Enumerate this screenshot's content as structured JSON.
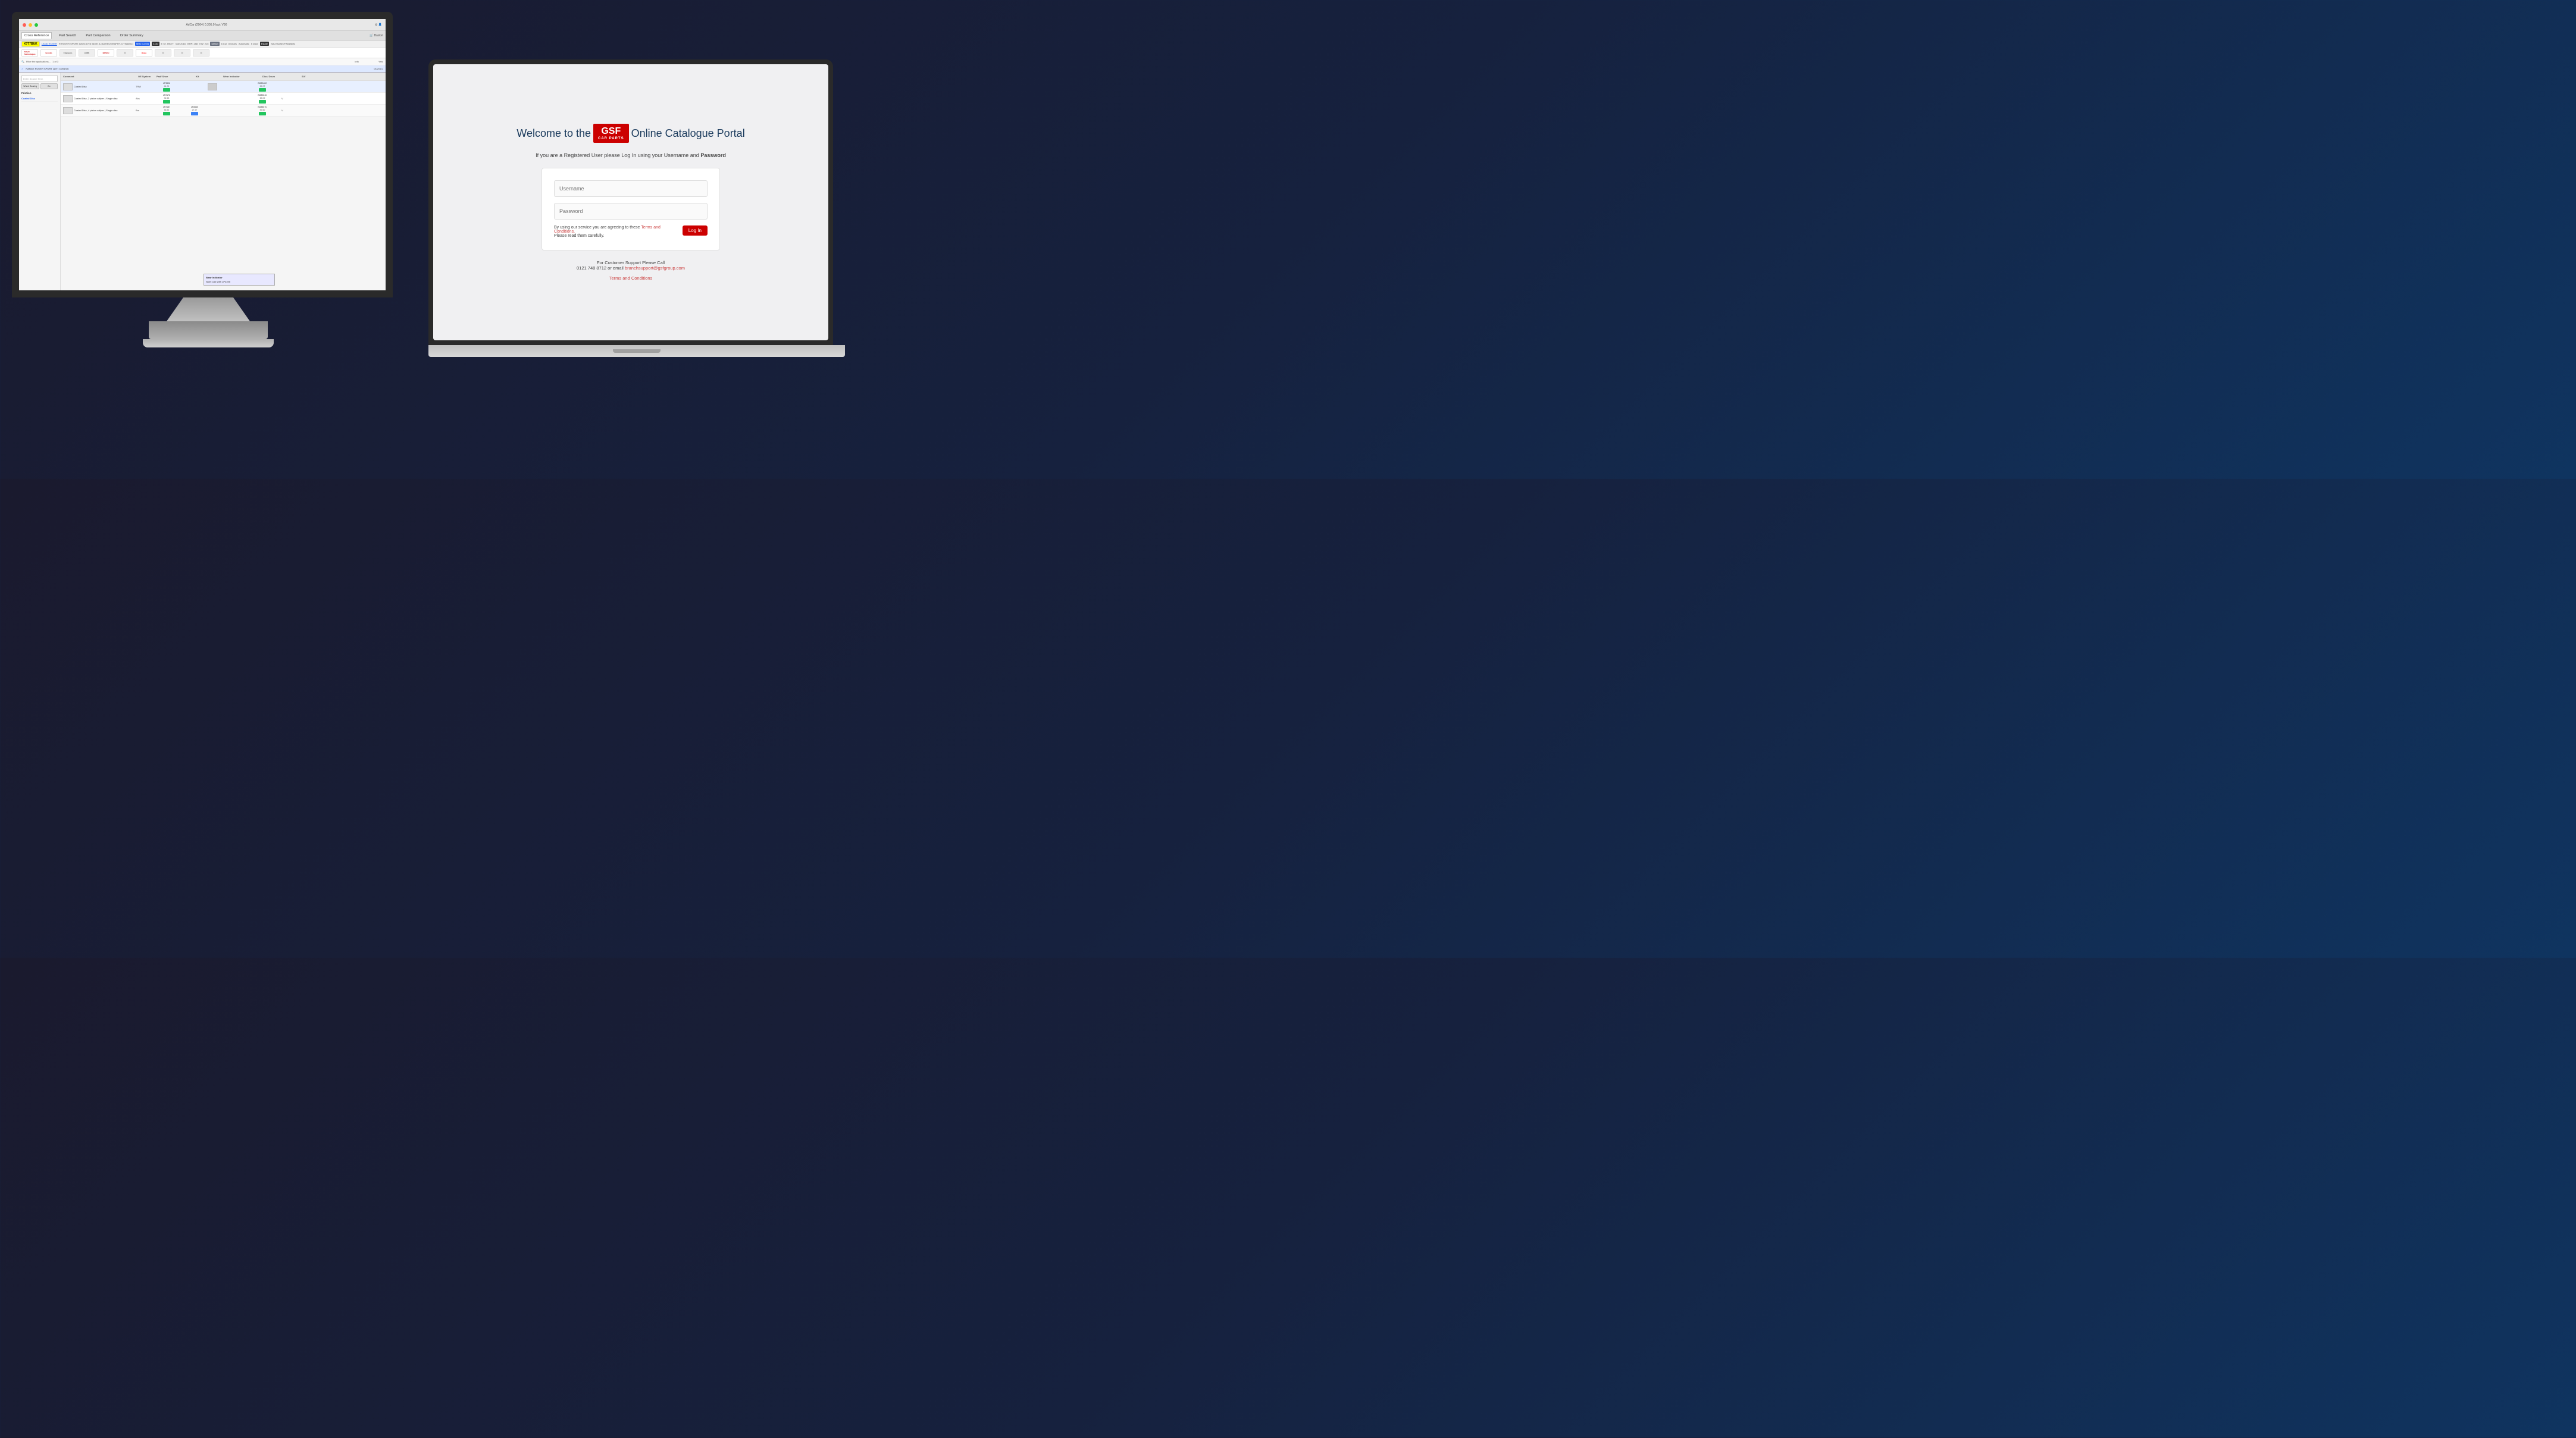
{
  "monitor": {
    "window_controls": [
      "red",
      "yellow",
      "green"
    ],
    "topbar_center": "AdCar (2964)  0.305.0  lapi: V90",
    "topbar_right": "⚙  👤"
  },
  "app": {
    "nav_tabs": [
      "Cross Reference",
      "Part Search",
      "Part Comparison",
      "Order Summary"
    ],
    "basket_label": "🛒 Basket",
    "reg_plate": "K777BUK",
    "vehicle_make": "LAND ROVER",
    "vehicle_model": "R ROVER SPORT A8OG DYN 5DVE A (AUTBIOGRAPHY, DYNAMIC)",
    "vehicle_mhz": "MH2 (L494)",
    "vehicle_body": "3.0D",
    "vehicle_engine": "E Or. 5907T",
    "vehicle_date": "Mar 2016",
    "vehicle_hp": "Hyp: 120/114",
    "vehicle_bhp": "BHP: 258",
    "vehicle_kw": "KW: 215",
    "vehicle_fuel": "Diesel",
    "vehicle_cyl": "6 Cyl",
    "vehicle_valve": "24 V",
    "vehicle_el": "El",
    "vehicle_gears": "8 Gears",
    "vehicle_trans": "Automatic",
    "vehicle_doors": "5 Door",
    "vehicle_body_style": "Estate",
    "vehicle_vin": "SALHA2AE7FA518892",
    "brands": [
      "Delphi Technologies",
      "brembo",
      "Champion",
      "LEMFÖRDER",
      "BOSCH",
      "Brake",
      "Autodata"
    ],
    "filter_text": "Filter the applications...",
    "filter_count": "1 of 3",
    "info_label": "Info",
    "year_label": "Year",
    "application": {
      "name": "RANGE ROVER SPORT (13+) 3.0SDV6",
      "year": "04/2013-"
    },
    "sidebar": {
      "search_placeholder": "Enter Search Term",
      "btn1": "Wheel Bearing",
      "btn2": "Go",
      "section": "Friction",
      "items": [
        "Coated Disc"
      ]
    },
    "table": {
      "columns": [
        "Comment",
        "OE System",
        "Pad/ Shoe",
        "Kit",
        "Wear Indicator",
        "Disc/ Drum",
        "S/V"
      ],
      "rows": [
        {
          "comment": "Coated Disc",
          "system": "TRW",
          "pad_num": "LP3396",
          "pad_size": "44.74",
          "disc_num": "BG8348C",
          "disc_size": "52.07"
        },
        {
          "comment": "Coated Disc, 2 piston caliper | Single disc",
          "system": "Abs",
          "pad_num": "LP2176",
          "pad_size": "32.63",
          "disc_num": "BG8304C",
          "disc_size": "65.09"
        },
        {
          "comment": "Coated Disc, 4 piston caliper | Single disc",
          "system": "Bre",
          "pad_num": "LP2187",
          "pad_size": "56.52",
          "kit_num": "LK0640",
          "kit_size": "27.27",
          "disc_num": "BG8807C",
          "disc_size": "59.60"
        }
      ]
    },
    "tooltip": {
      "title": "Wear Indicator",
      "text": "Note: Use with LP3395"
    }
  },
  "login": {
    "welcome_prefix": "Welcome to the",
    "gsf_logo_main": "GSF",
    "gsf_logo_sub": "CAR PARTS",
    "welcome_suffix": "Online Catalogue Portal",
    "subtitle": "If you are a Registered User please Log In using your Username and Password",
    "username_placeholder": "Username",
    "password_placeholder": "Password",
    "agree_text": "By using our service you are agreeing to these",
    "terms_link_text": "Terms and Conditions.",
    "read_text": "Please read them carefully.",
    "login_btn": "Log In",
    "support_prefix": "For Customer Support Please Call",
    "phone": "0121 748 8712",
    "or_text": "or email",
    "email": "branchsupport@gsfgroup.com",
    "toc_link": "Terms and Conditions"
  }
}
